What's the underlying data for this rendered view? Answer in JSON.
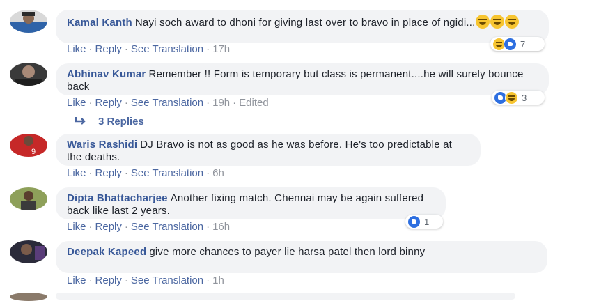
{
  "actions": {
    "like": "Like",
    "reply": "Reply",
    "see_translation": "See Translation",
    "separator": "·"
  },
  "comments": [
    {
      "author": "Kamal Kanth",
      "text": "Nayi soch award to dhoni for giving last over to bravo in place of ngidi...",
      "emoji_icons": [
        "laughing-emoji",
        "laughing-emoji",
        "laughing-emoji"
      ],
      "time": "17h",
      "edited": "",
      "reactions": {
        "icons": [
          "haha",
          "like"
        ],
        "count": "7"
      }
    },
    {
      "author": "Abhinav Kumar",
      "text": "Remember !! Form is temporary but class is permanent....he will surely bounce back",
      "time": "19h",
      "edited": "Edited",
      "reactions": {
        "icons": [
          "like",
          "haha"
        ],
        "count": "3"
      },
      "replies_label": "3 Replies"
    },
    {
      "author": "Waris Rashidi",
      "text": "DJ Bravo is not as good as he was before. He's too predictable at the deaths.",
      "time": "6h"
    },
    {
      "author": "Dipta Bhattacharjee",
      "text": "Another fixing match. Chennai may be again suffered back like last 2 years.",
      "time": "16h",
      "reactions": {
        "icons": [
          "like"
        ],
        "count": "1"
      }
    },
    {
      "author": "Deepak Kapeed",
      "text": "give more chances to payer lie harsa patel then lord binny",
      "time": "1h"
    }
  ],
  "colors": {
    "author": "#385898",
    "link": "#4b67a1",
    "bubble": "#f2f3f5",
    "meta": "#90949c",
    "like_blue": "#2e6fe0",
    "haha_yellow": "#f7c531"
  }
}
